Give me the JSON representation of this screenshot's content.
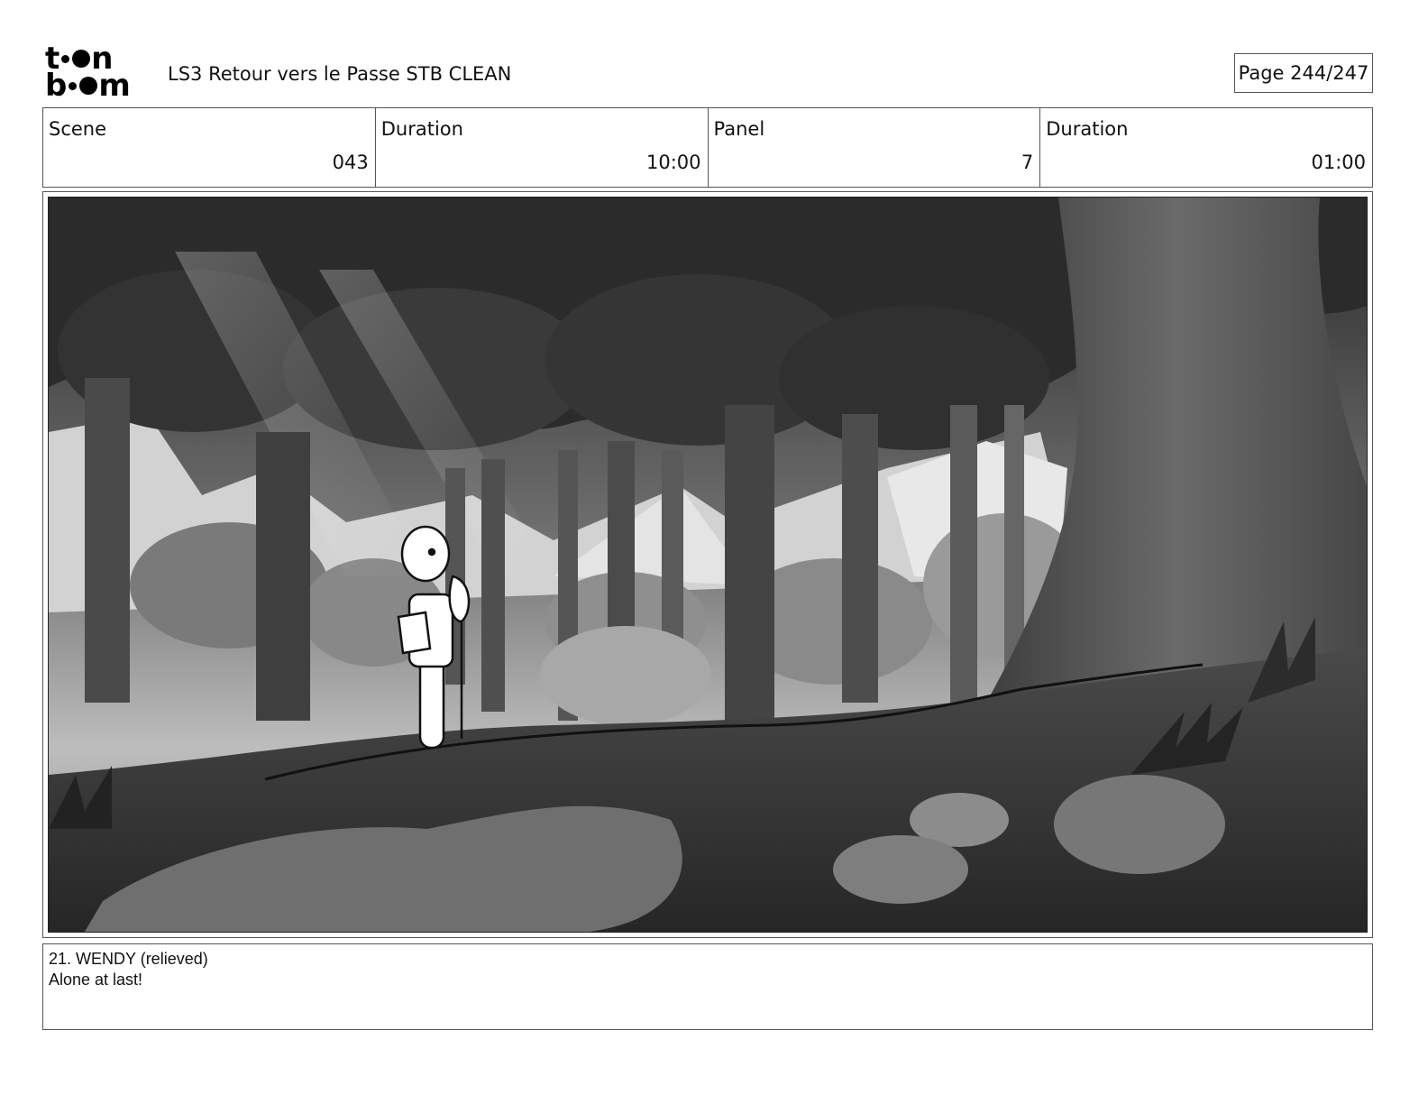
{
  "header": {
    "logo": {
      "top": "toon",
      "bottom": "boom"
    },
    "title": "LS3 Retour vers le Passe STB CLEAN",
    "page": "Page 244/247"
  },
  "info": {
    "scene_label": "Scene",
    "scene_value": "043",
    "scene_duration_label": "Duration",
    "scene_duration_value": "10:00",
    "panel_label": "Panel",
    "panel_value": "7",
    "panel_duration_label": "Duration",
    "panel_duration_value": "01:00"
  },
  "panel": {
    "image": "grayscale-forest-scene-with-character-holding-shovel"
  },
  "dialogue": {
    "line1": "21. WENDY (relieved)",
    "line2": "Alone at last!"
  }
}
